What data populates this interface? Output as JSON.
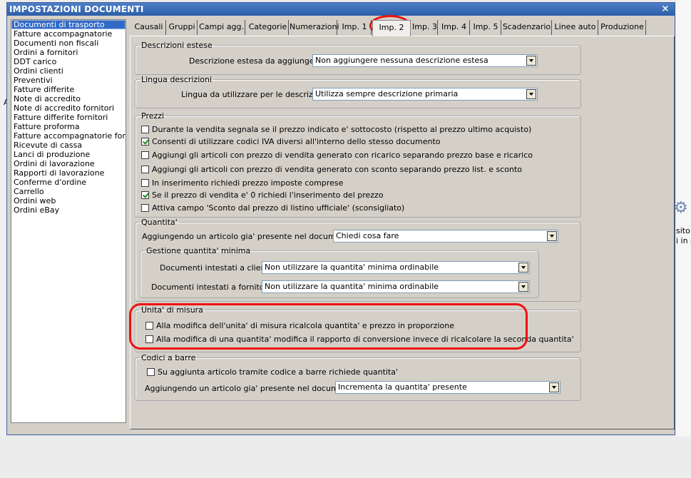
{
  "window": {
    "title": "IMPOSTAZIONI DOCUMENTI",
    "close": "×"
  },
  "doclist": [
    "Documenti di trasporto",
    "Fatture accompagnatorie",
    "Documenti non fiscali",
    "Ordini a fornitori",
    "DDT carico",
    "Ordini clienti",
    "Preventivi",
    "Fatture differite",
    "Note di accredito",
    "Note di accredito fornitori",
    "Fatture differite fornitori",
    "Fatture proforma",
    "Fatture accompagnatorie fornito",
    "Ricevute di cassa",
    "Lanci di produzione",
    "Ordini di lavorazione",
    "Rapporti di lavorazione",
    "Conferme d'ordine",
    "Carrello",
    "Ordini web",
    "Ordini eBay"
  ],
  "tabs": [
    "Causali",
    "Gruppi",
    "Campi agg.",
    "Categorie",
    "Numerazioni",
    "Imp. 1",
    "Imp. 2",
    "Imp. 3",
    "Imp. 4",
    "Imp. 5",
    "Scadenzario",
    "Linee auto",
    "Produzione"
  ],
  "active_tab": "Imp. 2",
  "descrizioni": {
    "legend": "Descrizioni estese",
    "label": "Descrizione estesa da aggiungere :",
    "value": "Non aggiungere nessuna descrizione estesa"
  },
  "lingua": {
    "legend": "Lingua descrizioni",
    "label": "Lingua da utilizzare per le descrizioni :",
    "value": "Utilizza sempre descrizione primaria"
  },
  "prezzi": {
    "legend": "Prezzi",
    "items": [
      {
        "label": "Durante la vendita segnala se il prezzo indicato e' sottocosto (rispetto al prezzo ultimo acquisto)",
        "checked": false
      },
      {
        "label": "Consenti di utilizzare codici IVA diversi all'interno dello stesso documento",
        "checked": true
      },
      {
        "label": "Aggiungi gli articoli con prezzo di vendita generato con ricarico separando prezzo base e ricarico",
        "checked": false
      },
      {
        "label": "Aggiungi gli articoli con prezzo di vendita generato con sconto separando prezzo list. e sconto",
        "checked": false
      },
      {
        "label": "In inserimento richiedi prezzo imposte comprese",
        "checked": false
      },
      {
        "label": "Se il prezzo di vendita e' 0 richiedi l'inserimento del prezzo",
        "checked": true
      },
      {
        "label": "Attiva campo 'Sconto dal prezzo di listino ufficiale' (sconsigliato)",
        "checked": false
      }
    ]
  },
  "quantita": {
    "legend": "Quantita'",
    "label": "Aggiungendo un articolo gia' presente nel documento :",
    "value": "Chiedi cosa fare",
    "minima": {
      "legend": "Gestione quantita' minima",
      "clienti_label": "Documenti intestati a clienti :",
      "clienti_value": "Non utilizzare la quantita' minima ordinabile",
      "fornitori_label": "Documenti intestati a fornitori :",
      "fornitori_value": "Non utilizzare la quantita' minima ordinabile"
    }
  },
  "unita": {
    "legend": "Unita' di misura",
    "items": [
      {
        "label": "Alla modifica dell'unita' di misura ricalcola quantita' e prezzo in proporzione",
        "checked": false
      },
      {
        "label": "Alla modifica di una quantita' modifica il rapporto di conversione invece di ricalcolare la seconda quantita'",
        "checked": false
      }
    ]
  },
  "barre": {
    "legend": "Codici a barre",
    "checkbox": {
      "label": "Su aggiunta articolo tramite codice a barre richiede quantita'",
      "checked": false
    },
    "label": "Aggiungendo un articolo gia' presente nel documento :",
    "value": "Incrementa la quantita' presente"
  },
  "background": {
    "side_text_1": "sito",
    "side_text_2": "i in c",
    "stray_letter": "A"
  },
  "colors": {
    "titlebar": "#2c5ea9",
    "selection": "#316ac5",
    "annotation": "#e11111",
    "panel": "#d4d0c8"
  }
}
